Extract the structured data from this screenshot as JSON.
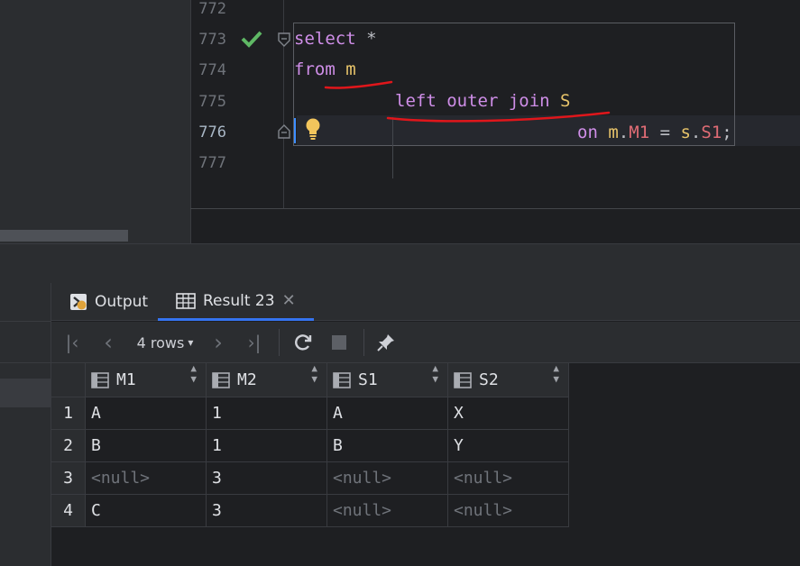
{
  "editor": {
    "line_numbers": [
      "772",
      "773",
      "774",
      "775",
      "776",
      "777"
    ],
    "lines": [
      {
        "number": "773",
        "tokens": [
          {
            "t": "select",
            "c": "kw"
          },
          {
            "t": " *",
            "c": "plain"
          }
        ]
      },
      {
        "number": "774",
        "tokens": [
          {
            "t": "from",
            "c": "kw"
          },
          {
            "t": " ",
            "c": "plain"
          },
          {
            "t": "m",
            "c": "id"
          }
        ]
      },
      {
        "number": "775",
        "tokens": [
          {
            "t": "left outer join",
            "c": "kw"
          },
          {
            "t": " ",
            "c": "plain"
          },
          {
            "t": "S",
            "c": "id"
          }
        ]
      },
      {
        "number": "776",
        "tokens": [
          {
            "t": "on",
            "c": "kw"
          },
          {
            "t": " ",
            "c": "plain"
          },
          {
            "t": "m",
            "c": "id"
          },
          {
            "t": ".",
            "c": "plain"
          },
          {
            "t": "M1",
            "c": "col"
          },
          {
            "t": " = ",
            "c": "plain"
          },
          {
            "t": "s",
            "c": "id"
          },
          {
            "t": ".",
            "c": "plain"
          },
          {
            "t": "S1",
            "c": "col"
          },
          {
            "t": ";",
            "c": "plain"
          }
        ]
      }
    ],
    "status_icon": "check-icon",
    "intention_icon": "lightbulb-icon",
    "colors": {
      "keyword": "#cf8ee8",
      "identifier": "#e8c46a",
      "column": "#e06c75",
      "annotation": "#e0161b"
    }
  },
  "results": {
    "tabs": [
      {
        "label": "Output",
        "icon": "output-icon",
        "active": false
      },
      {
        "label": "Result 23",
        "icon": "table-icon",
        "active": true,
        "closable": true
      }
    ],
    "toolbar": {
      "rows_label": "4 rows",
      "buttons": [
        "first-page-icon",
        "prev-page-icon",
        "next-page-icon",
        "last-page-icon",
        "refresh-icon",
        "stop-icon",
        "pin-icon"
      ]
    },
    "columns": [
      "M1",
      "M2",
      "S1",
      "S2"
    ],
    "rows": [
      {
        "num": "1",
        "cells": [
          "A",
          "1",
          "A",
          "X"
        ]
      },
      {
        "num": "2",
        "cells": [
          "B",
          "1",
          "B",
          "Y"
        ]
      },
      {
        "num": "3",
        "cells": [
          "<null>",
          "3",
          "<null>",
          "<null>"
        ]
      },
      {
        "num": "4",
        "cells": [
          "C",
          "3",
          "<null>",
          "<null>"
        ]
      }
    ]
  }
}
